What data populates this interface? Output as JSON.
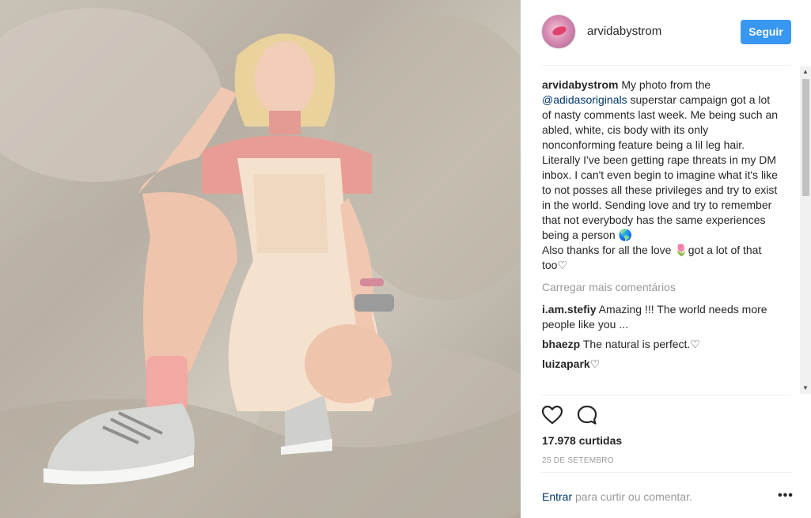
{
  "post": {
    "image_alt": "Photo of a woman sitting in a lace dress and sneakers"
  },
  "header": {
    "username": "arvidabystrom",
    "follow_label": "Seguir"
  },
  "caption": {
    "author": "arvidabystrom",
    "text_before_mention": " My photo from the ",
    "mention": "@adidasoriginals",
    "text_after_mention": " superstar campaign got a lot of nasty comments last week. Me being such an abled, white, cis body with its only nonconforming feature being a lil leg hair. Literally I've been getting rape threats in my DM inbox. I can't even begin to imagine what it's like to not posses all these privileges and try to exist in the world. Sending love and try to remember that not everybody has the same experiences being a person 🌎\nAlso thanks for all the love 🌷got a lot of that too♡"
  },
  "load_more_label": "Carregar mais comentários",
  "comments": [
    {
      "user": "i.am.stefiy",
      "text": " Amazing !!! The world needs more people like you ..."
    },
    {
      "user": "bhaezp",
      "text": " The natural is perfect.♡"
    },
    {
      "user": "luizapark",
      "text": "♡"
    }
  ],
  "actions": {
    "like_icon": "heart-icon",
    "comment_icon": "comment-bubble-icon"
  },
  "likes_text": "17.978 curtidas",
  "date_text": "25 DE SETEMBRO",
  "login": {
    "link_label": "Entrar",
    "rest_text": " para curtir ou comentar."
  },
  "more_label": "•••",
  "scrollbar": {
    "up": "▲",
    "down": "▼"
  }
}
